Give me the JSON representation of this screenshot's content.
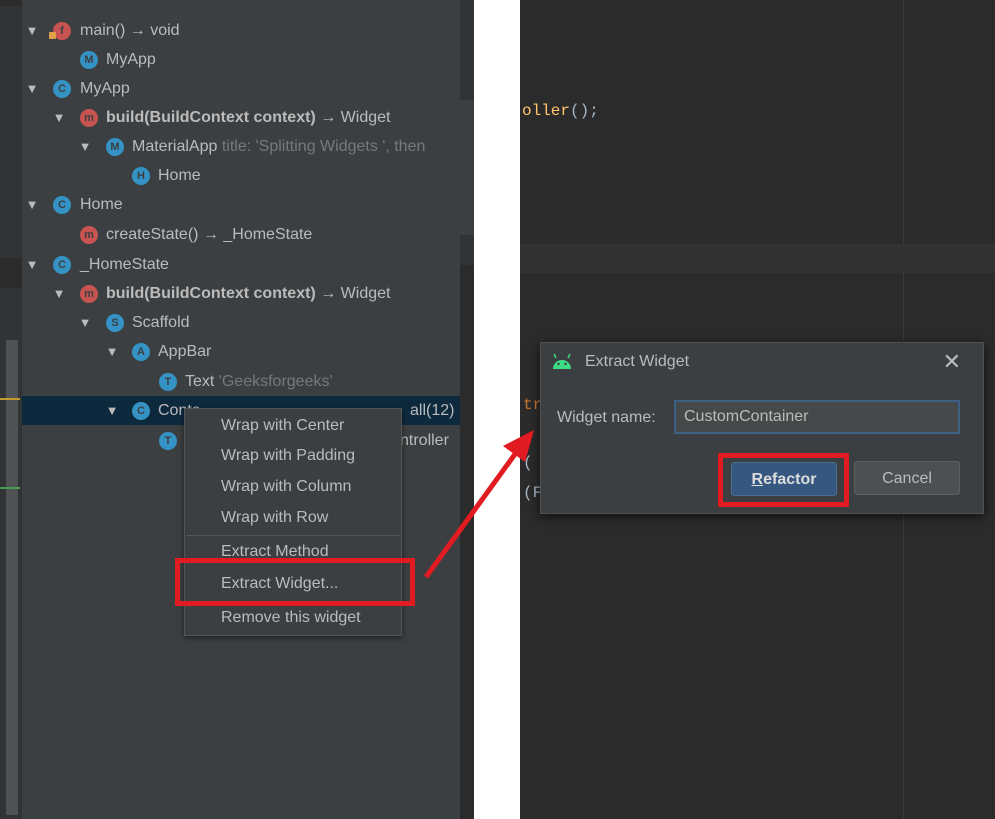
{
  "outline": {
    "rows": [
      {
        "icon": "f",
        "label": "main() → void"
      },
      {
        "icon": "M",
        "label": "MyApp"
      },
      {
        "icon": "C",
        "label": "MyApp"
      },
      {
        "icon": "m",
        "label": "build(BuildContext context)",
        "suffix": " → Widget"
      },
      {
        "icon": "M",
        "label": "MaterialApp",
        "extra": "title: 'Splitting Widgets ', then"
      },
      {
        "icon": "H",
        "label": "Home"
      },
      {
        "icon": "C",
        "label": "Home"
      },
      {
        "icon": "m",
        "label": "createState() → _HomeState"
      },
      {
        "icon": "C",
        "label": "_HomeState"
      },
      {
        "icon": "m",
        "label": "build(BuildContext context)",
        "suffix": " → Widget"
      },
      {
        "icon": "S",
        "label": "Scaffold"
      },
      {
        "icon": "A",
        "label": "AppBar"
      },
      {
        "icon": "T",
        "label": "Text",
        "extra": "'Geeksforgeeks'"
      },
      {
        "icon": "C",
        "label": "Conta",
        "extra": "all(12)"
      },
      {
        "icon": "T",
        "label": "",
        "extra": "ntroller"
      }
    ]
  },
  "context_menu": {
    "items": [
      "Wrap with Center",
      "Wrap with Padding",
      "Wrap with Column",
      "Wrap with Row",
      "Extract Method",
      "Extract Widget...",
      "Remove this widget"
    ]
  },
  "editor": {
    "line1_a": "oller",
    "line1_b": "();",
    "frag_tr": "tr",
    "frag_paren1": "(",
    "frag_paren2": "(F"
  },
  "dialog": {
    "title": "Extract Widget",
    "close_glyph": "✕",
    "name_label": "Widget name:",
    "name_value": "CustomContainer",
    "refactor_first": "R",
    "refactor_rest": "efactor",
    "cancel_label": "Cancel"
  },
  "colors": {
    "highlight": "#e11b22",
    "accent": "#365880"
  },
  "icons": {
    "expand": "triangle-down-icon",
    "close": "close-icon",
    "android": "android-icon"
  }
}
